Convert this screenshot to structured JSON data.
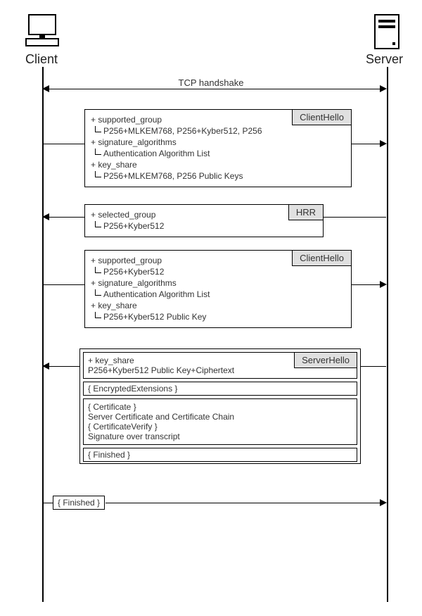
{
  "actors": {
    "client": "Client",
    "server": "Server"
  },
  "tcp_handshake_label": "TCP handshake",
  "client_hello_1": {
    "tag": "ClientHello",
    "supported_group_label": "+ supported_group",
    "supported_group_value": "P256+MLKEM768, P256+Kyber512, P256",
    "signature_algorithms_label": "+ signature_algorithms",
    "signature_algorithms_value": "Authentication Algorithm List",
    "key_share_label": "+ key_share",
    "key_share_value": "P256+MLKEM768, P256 Public Keys"
  },
  "hrr": {
    "tag": "HRR",
    "selected_group_label": "+ selected_group",
    "selected_group_value": "P256+Kyber512"
  },
  "client_hello_2": {
    "tag": "ClientHello",
    "supported_group_label": "+ supported_group",
    "supported_group_value": "P256+Kyber512",
    "signature_algorithms_label": "+ signature_algorithms",
    "signature_algorithms_value": "Authentication Algorithm List",
    "key_share_label": "+ key_share",
    "key_share_value": "P256+Kyber512 Public Key"
  },
  "server_flight": {
    "server_hello_tag": "ServerHello",
    "key_share_label": "+ key_share",
    "key_share_value": "P256+Kyber512 Public Key+Ciphertext",
    "encrypted_extensions": "{ EncryptedExtensions }",
    "certificate_label": "{ Certificate }",
    "certificate_value": "Server Certificate and Certificate Chain",
    "certificate_verify_label": "{ CertificateVerify }",
    "certificate_verify_value": "Signature over transcript",
    "finished": "{ Finished }"
  },
  "client_finished": "{ Finished }"
}
